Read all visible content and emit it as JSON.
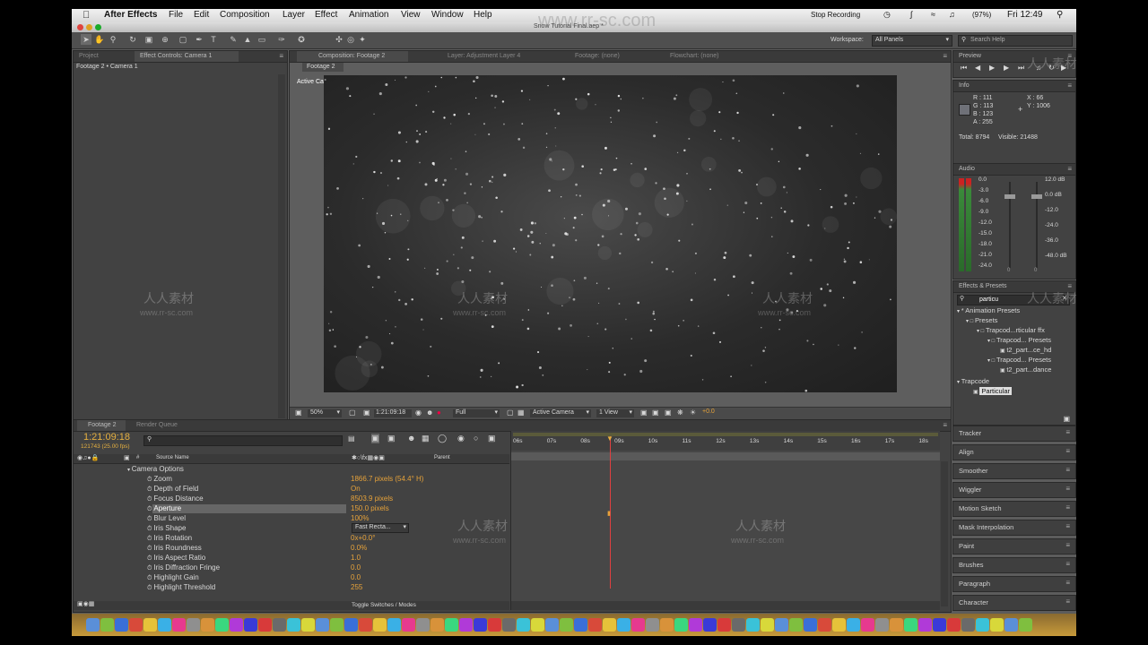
{
  "menubar": {
    "app": "After Effects",
    "items": [
      "File",
      "Edit",
      "Composition",
      "Layer",
      "Effect",
      "Animation",
      "View",
      "Window",
      "Help"
    ],
    "recording": "Stop Recording",
    "battery": "(97%)",
    "clock": "Fri 12:49"
  },
  "window_title": "Snow Tutorial Final.aep *",
  "toolbar": {
    "workspace_label": "Workspace:",
    "workspace_value": "All Panels",
    "search_placeholder": "Search Help"
  },
  "project_panel": {
    "tab_project": "Project",
    "tab_effect_controls": "Effect Controls: Camera 1",
    "breadcrumb": "Footage 2 • Camera 1"
  },
  "comp_panel": {
    "tab_comp": "Composition: Footage 2",
    "tab_layer": "Layer: Adjustment Layer 4",
    "tab_footage": "Footage: (none)",
    "tab_flowchart": "Flowchart: (none)",
    "sub_tab": "Footage 2",
    "view_label": "Active Camera",
    "zoom": "50%",
    "timecode": "1:21:09:18",
    "resolution": "Full",
    "camera": "Active Camera",
    "views": "1 View",
    "exposure": "+0.0"
  },
  "preview_panel": {
    "title": "Preview"
  },
  "info_panel": {
    "title": "Info",
    "r": "R : 111",
    "g": "G : 113",
    "b": "B : 123",
    "a": "A : 255",
    "x": "X : 66",
    "y": "Y : 1006",
    "total": "Total: 8794",
    "visible": "Visible: 21488"
  },
  "audio_panel": {
    "title": "Audio",
    "left_scale": [
      "0.0",
      "-3.0",
      "-6.0",
      "-9.0",
      "-12.0",
      "-15.0",
      "-18.0",
      "-21.0",
      "-24.0"
    ],
    "right_scale": [
      "12.0 dB",
      "0.0 dB",
      "-12.0",
      "-24.0",
      "-36.0",
      "-48.0 dB"
    ],
    "slider_left": "0",
    "slider_right": "0"
  },
  "effects_panel": {
    "title": "Effects & Presets",
    "search": "particu",
    "tree": [
      "* Animation Presets",
      "Presets",
      "Trapcod...rticular ffx",
      "Trapcod... Presets",
      "t2_part...ce_hd",
      "Trapcod... Presets",
      "t2_part...dance",
      "Trapcode",
      "Particular"
    ]
  },
  "side_panels": [
    "Tracker",
    "Align",
    "Smoother",
    "Wiggler",
    "Motion Sketch",
    "Mask Interpolation",
    "Paint",
    "Brushes",
    "Paragraph",
    "Character"
  ],
  "timeline": {
    "tab": "Footage 2",
    "tab_render": "Render Queue",
    "timecode": "1:21:09:18",
    "frames": "121743 (25.00 fps)",
    "col_source": "Source Name",
    "col_parent": "Parent",
    "ruler": [
      "06s",
      "07s",
      "08s",
      "09s",
      "10s",
      "11s",
      "12s",
      "13s",
      "14s",
      "15s",
      "16s",
      "17s",
      "18s"
    ],
    "rows": [
      {
        "name": "Camera Options",
        "value": ""
      },
      {
        "name": "Zoom",
        "value": "1866.7 pixels (54.4° H)"
      },
      {
        "name": "Depth of Field",
        "value": "On"
      },
      {
        "name": "Focus Distance",
        "value": "8503.9 pixels"
      },
      {
        "name": "Aperture",
        "value": "150.0 pixels"
      },
      {
        "name": "Blur Level",
        "value": "100%"
      },
      {
        "name": "Iris Shape",
        "value": "Fast Recta..."
      },
      {
        "name": "Iris Rotation",
        "value": "0x+0.0°"
      },
      {
        "name": "Iris Roundness",
        "value": "0.0%"
      },
      {
        "name": "Iris Aspect Ratio",
        "value": "1.0"
      },
      {
        "name": "Iris Diffraction Fringe",
        "value": "0.0"
      },
      {
        "name": "Highlight Gain",
        "value": "0.0"
      },
      {
        "name": "Highlight Threshold",
        "value": "255"
      }
    ],
    "toggle": "Toggle Switches / Modes"
  },
  "watermark": {
    "brand": "人人素材",
    "url": "www.rr-sc.com"
  }
}
